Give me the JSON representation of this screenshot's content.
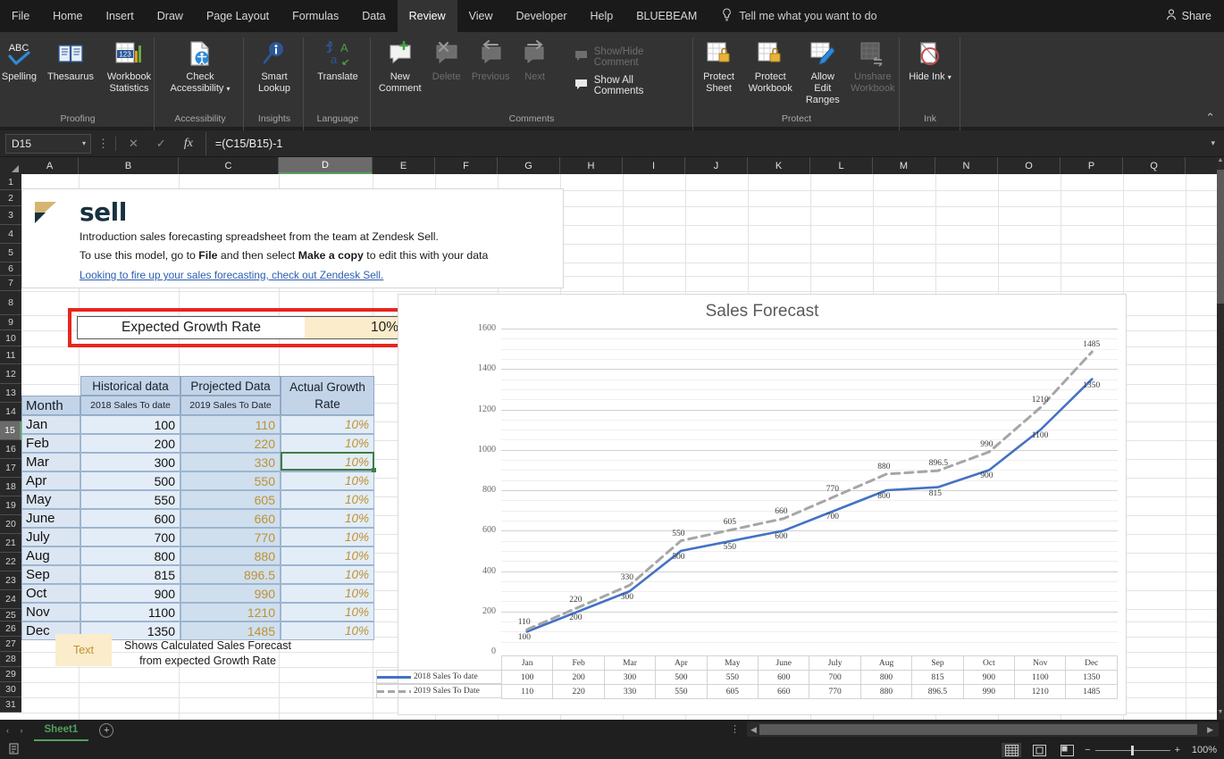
{
  "ribbon_tabs": [
    {
      "label": "File",
      "active": false
    },
    {
      "label": "Home",
      "active": false
    },
    {
      "label": "Insert",
      "active": false
    },
    {
      "label": "Draw",
      "active": false
    },
    {
      "label": "Page Layout",
      "active": false
    },
    {
      "label": "Formulas",
      "active": false
    },
    {
      "label": "Data",
      "active": false
    },
    {
      "label": "Review",
      "active": true
    },
    {
      "label": "View",
      "active": false
    },
    {
      "label": "Developer",
      "active": false
    },
    {
      "label": "Help",
      "active": false
    },
    {
      "label": "BLUEBEAM",
      "active": false
    }
  ],
  "tell_me": "Tell me what you want to do",
  "share_label": "Share",
  "ribbon_groups": [
    {
      "name": "Proofing",
      "buttons": [
        {
          "label": "Spelling",
          "icon": "spelling-icon",
          "disabled": false
        },
        {
          "label": "Thesaurus",
          "icon": "thesaurus-icon",
          "disabled": false
        },
        {
          "label": "Workbook Statistics",
          "icon": "workbook-statistics-icon",
          "disabled": false
        }
      ]
    },
    {
      "name": "Accessibility",
      "buttons": [
        {
          "label": "Check Accessibility",
          "icon": "check-accessibility-icon",
          "disabled": false,
          "dropdown": true
        }
      ]
    },
    {
      "name": "Insights",
      "buttons": [
        {
          "label": "Smart Lookup",
          "icon": "smart-lookup-icon",
          "disabled": false
        }
      ]
    },
    {
      "name": "Language",
      "buttons": [
        {
          "label": "Translate",
          "icon": "translate-icon",
          "disabled": false
        }
      ]
    },
    {
      "name": "Comments",
      "buttons": [
        {
          "label": "New Comment",
          "icon": "new-comment-icon",
          "disabled": false
        },
        {
          "label": "Delete",
          "icon": "delete-comment-icon",
          "disabled": true
        },
        {
          "label": "Previous",
          "icon": "previous-comment-icon",
          "disabled": true
        },
        {
          "label": "Next",
          "icon": "next-comment-icon",
          "disabled": true
        }
      ],
      "small_buttons": [
        {
          "label": "Show/Hide Comment",
          "icon": "show-hide-comment-icon",
          "disabled": true
        },
        {
          "label": "Show All Comments",
          "icon": "show-all-comments-icon",
          "disabled": false
        }
      ]
    },
    {
      "name": "Protect",
      "buttons": [
        {
          "label": "Protect Sheet",
          "icon": "protect-sheet-icon",
          "disabled": false
        },
        {
          "label": "Protect Workbook",
          "icon": "protect-workbook-icon",
          "disabled": false
        },
        {
          "label": "Allow Edit Ranges",
          "icon": "allow-edit-ranges-icon",
          "disabled": false
        },
        {
          "label": "Unshare Workbook",
          "icon": "unshare-workbook-icon",
          "disabled": true
        }
      ]
    },
    {
      "name": "Ink",
      "buttons": [
        {
          "label": "Hide Ink",
          "icon": "hide-ink-icon",
          "disabled": false,
          "dropdown": true
        }
      ]
    }
  ],
  "formula_bar": {
    "name_box": "D15",
    "formula": "=(C15/B15)-1"
  },
  "grid": {
    "columns": [
      "A",
      "B",
      "C",
      "D",
      "E",
      "F",
      "G",
      "H",
      "I",
      "J",
      "K",
      "L",
      "M",
      "N",
      "O",
      "P",
      "Q"
    ],
    "selected_column": "D",
    "selected_row": 15,
    "rows": [
      1,
      2,
      3,
      4,
      5,
      6,
      7,
      8,
      9,
      10,
      11,
      12,
      13,
      14,
      15,
      16,
      17,
      18,
      19,
      20,
      21,
      22,
      23,
      24,
      25,
      26,
      27,
      28,
      29,
      30,
      31
    ]
  },
  "zendesk_box": {
    "logo_alt": "zendesk-sell-logo",
    "brand": "sell",
    "line1": "Introduction sales forecasting spreadsheet from the team at Zendesk Sell.",
    "line2_a": "To use this model, go to ",
    "line2_b": "File",
    "line2_c": " and then select ",
    "line2_d": "Make a copy",
    "line2_e": " to edit this with your data",
    "link": "Looking to fire up your sales forecasting, check out Zendesk Sell."
  },
  "growth_rate": {
    "label": "Expected Growth Rate",
    "value": "10%"
  },
  "table": {
    "group_headers": [
      "Historical data",
      "Projected Data",
      "Actual Growth Rate"
    ],
    "sub_headers": [
      "Month",
      "2018 Sales To date",
      "2019 Sales To Date",
      ""
    ],
    "rows": [
      {
        "month": "Jan",
        "historical": "100",
        "projected": "110",
        "growth": "10%"
      },
      {
        "month": "Feb",
        "historical": "200",
        "projected": "220",
        "growth": "10%"
      },
      {
        "month": "Mar",
        "historical": "300",
        "projected": "330",
        "growth": "10%"
      },
      {
        "month": "Apr",
        "historical": "500",
        "projected": "550",
        "growth": "10%"
      },
      {
        "month": "May",
        "historical": "550",
        "projected": "605",
        "growth": "10%"
      },
      {
        "month": "June",
        "historical": "600",
        "projected": "660",
        "growth": "10%"
      },
      {
        "month": "July",
        "historical": "700",
        "projected": "770",
        "growth": "10%"
      },
      {
        "month": "Aug",
        "historical": "800",
        "projected": "880",
        "growth": "10%"
      },
      {
        "month": "Sep",
        "historical": "815",
        "projected": "896.5",
        "growth": "10%"
      },
      {
        "month": "Oct",
        "historical": "900",
        "projected": "990",
        "growth": "10%"
      },
      {
        "month": "Nov",
        "historical": "1100",
        "projected": "1210",
        "growth": "10%"
      },
      {
        "month": "Dec",
        "historical": "1350",
        "projected": "1485",
        "growth": "10%"
      }
    ]
  },
  "key_note": {
    "swatch_label": "Text",
    "line1": "Shows Calculated Sales Forecast",
    "line2": "from expected Growth Rate"
  },
  "chart_data": {
    "type": "line",
    "title": "Sales Forecast",
    "xlabel": "",
    "ylabel": "",
    "ylim": [
      0,
      1600
    ],
    "ytick_step": 200,
    "minor_step": 50,
    "grid": true,
    "legend_position": "data-table",
    "show_data_table": true,
    "show_data_labels": true,
    "categories": [
      "Jan",
      "Feb",
      "Mar",
      "Apr",
      "May",
      "June",
      "July",
      "Aug",
      "Sep",
      "Oct",
      "Nov",
      "Dec"
    ],
    "yticks": [
      0,
      200,
      400,
      600,
      800,
      1000,
      1200,
      1400,
      1600
    ],
    "series": [
      {
        "name": "2018 Sales To date",
        "color": "#4472c4",
        "style": "solid",
        "values": [
          100,
          200,
          300,
          500,
          550,
          600,
          700,
          800,
          815,
          900,
          1100,
          1350
        ]
      },
      {
        "name": "2019 Sales To Date",
        "color": "#a6a6a6",
        "style": "dashed",
        "values": [
          110,
          220,
          330,
          550,
          605,
          660,
          770,
          880,
          896.5,
          990,
          1210,
          1485
        ]
      }
    ]
  },
  "sheet_tabs": {
    "tabs": [
      "Sheet1"
    ],
    "active": "Sheet1",
    "add_label": "+"
  },
  "status_bar": {
    "view_buttons": [
      "normal-view",
      "page-layout-view",
      "page-break-view"
    ],
    "active_view": "normal-view",
    "zoom": "100%",
    "zoom_out": "−",
    "zoom_in": "+"
  },
  "colors": {
    "accent_blue": "#4472c4",
    "gray_series": "#a6a6a6",
    "highlight_red": "#e8251f",
    "gold_text": "#bf9133",
    "selection_green": "#3f7d46"
  }
}
